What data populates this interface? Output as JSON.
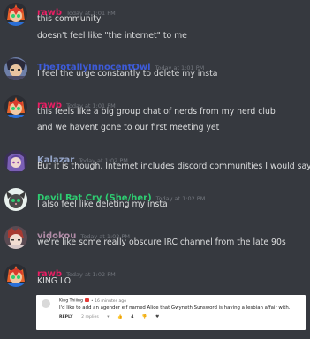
{
  "colors": {
    "background": "#36393f",
    "text": "#dcddde",
    "timestamp": "#72767d",
    "rawb": "#e91e63",
    "thetotally": "#3d5bd9",
    "kalazar": "#95a5c9",
    "devilratcry": "#2ecc71",
    "vidokou": "#b08ba6"
  },
  "messages": [
    {
      "username": "rawb",
      "timestamp": "Today at 1:01 PM",
      "lines": [
        "this community",
        "doesn't feel like \"the internet\" to me"
      ]
    },
    {
      "username": "TheTotallyInnocentOwl",
      "timestamp": "Today at 1:01 PM",
      "lines": [
        "I feel the urge constantly to delete my insta"
      ]
    },
    {
      "username": "rawb",
      "timestamp": "Today at 1:01 PM",
      "lines": [
        "this feels like a big group chat of nerds from my nerd club",
        "and we havent gone to our first meeting yet"
      ]
    },
    {
      "username": "Kalazar",
      "timestamp": "Today at 1:02 PM",
      "lines": [
        "But it is though. Internet includes discord communities I would say"
      ]
    },
    {
      "username": "Devil Rat Cry (She/her)",
      "timestamp": "Today at 1:02 PM",
      "lines": [
        "I also feel like deleting my insta"
      ]
    },
    {
      "username": "vidokou",
      "timestamp": "Today at 1:02 PM",
      "lines": [
        "we're like some really obscure IRC channel from the late 90s"
      ]
    },
    {
      "username": "rawb",
      "timestamp": "Today at 1:02 PM",
      "lines": [
        "KING LOL"
      ]
    }
  ],
  "embed": {
    "author": "King Thiiing",
    "time": "• 16 minutes ago",
    "text": "I'd like to add an agender elf named Alice that Gwyneth Sunsword is having a lesbian affair with.",
    "reply_label": "REPLY",
    "replies_label": "2 replies",
    "likes": "4"
  }
}
